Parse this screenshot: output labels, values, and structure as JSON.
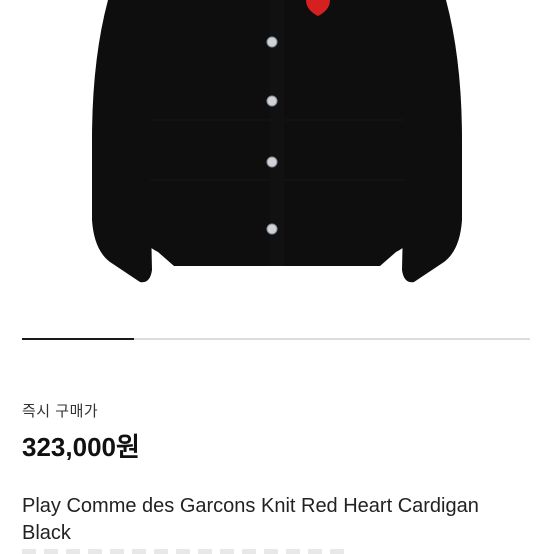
{
  "product": {
    "image_label": "cardigan-product-photo",
    "logo_color": "#d62020",
    "garment_color": "#0e0e0e",
    "button_color": "#cfd3d8",
    "image_progress": 0.22
  },
  "listing": {
    "purchase_type": "즉시 구매가",
    "price": "323,000원",
    "title": "Play Comme des Garcons Knit Red Heart Cardigan Black"
  }
}
